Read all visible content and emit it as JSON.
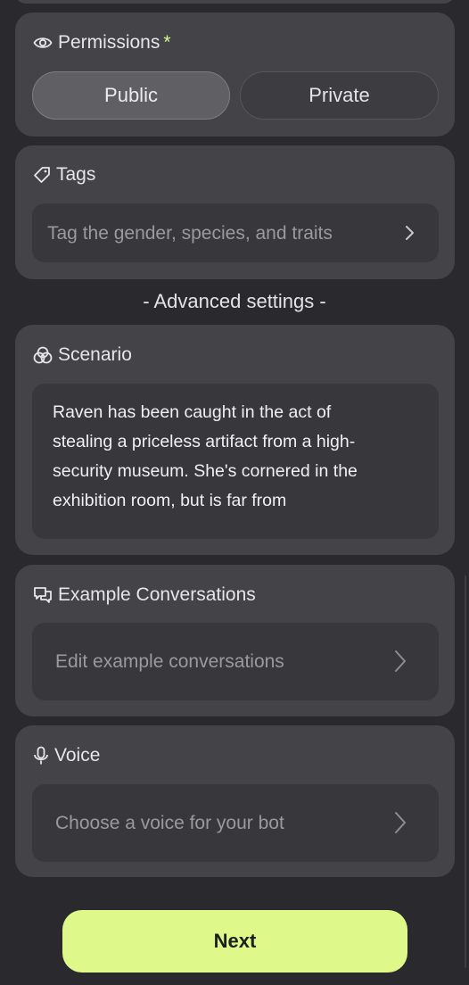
{
  "permissions": {
    "title": "Permissions",
    "required_mark": "*",
    "options": [
      "Public",
      "Private"
    ],
    "selected": "Public"
  },
  "tags": {
    "title": "Tags",
    "placeholder": "Tag the gender, species, and traits"
  },
  "advanced_settings_label": "- Advanced settings -",
  "scenario": {
    "title": "Scenario",
    "text": "Raven has been caught in the act of stealing a priceless artifact from a high-security museum. She's cornered in the exhibition room, but is far from"
  },
  "example_conversations": {
    "title": "Example Conversations",
    "placeholder": "Edit example conversations"
  },
  "voice": {
    "title": "Voice",
    "placeholder": "Choose a voice for your bot"
  },
  "next_label": "Next",
  "colors": {
    "background": "#2a2a2e",
    "card": "#434348",
    "field": "#38383c",
    "accent": "#def98a"
  },
  "icons": [
    "eye-icon",
    "tag-icon",
    "scenario-icon",
    "chat-bubbles-icon",
    "microphone-icon",
    "chevron-right-icon"
  ]
}
